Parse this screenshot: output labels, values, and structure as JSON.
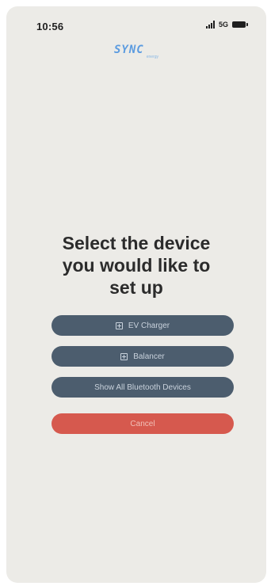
{
  "status_bar": {
    "time": "10:56",
    "network": "5G",
    "icons": [
      "cellular-signal-icon",
      "battery-icon"
    ]
  },
  "logo": {
    "word": "SYNC",
    "sub": "energy",
    "color": "#5b9be0"
  },
  "headline": {
    "line1": "Select the device",
    "line2": "you would like to",
    "line3": "set up"
  },
  "buttons": {
    "ev_charger": {
      "label": "EV Charger",
      "icon": "plus-square-icon"
    },
    "balancer": {
      "label": "Balancer",
      "icon": "plus-square-icon"
    },
    "show_bluetooth": {
      "label": "Show All Bluetooth Devices"
    },
    "cancel": {
      "label": "Cancel"
    }
  },
  "colors": {
    "background": "#ecebe7",
    "primary_button": "#4c5d6e",
    "cancel_button": "#d6594e",
    "text": "#2b2b2b"
  }
}
